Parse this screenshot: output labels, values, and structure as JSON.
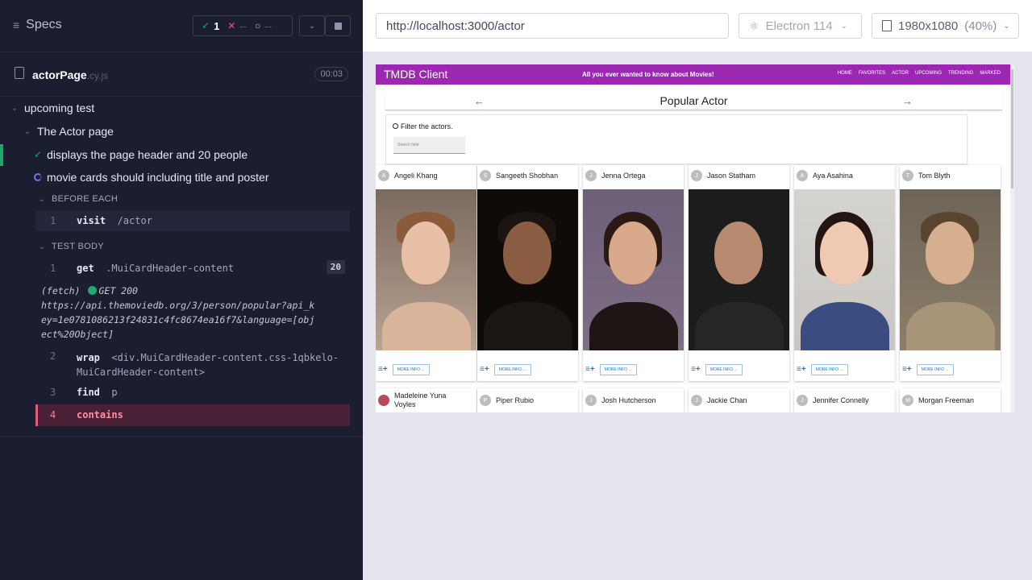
{
  "reporter": {
    "header": {
      "title": "Specs",
      "passed_count": "1",
      "failed_count": "--",
      "pending_count": "--"
    },
    "spec": {
      "name": "actorPage",
      "ext": ".cy.js",
      "time": "00:03"
    },
    "tree": {
      "suite": "upcoming test",
      "subsuite": "The Actor page",
      "test_pass": "displays the page header and 20 people",
      "test_running": "movie cards should including title and poster",
      "before_each_label": "BEFORE EACH",
      "test_body_label": "TEST BODY"
    },
    "commands": {
      "before_each": [
        {
          "num": "1",
          "name": "visit",
          "arg": "/actor"
        }
      ],
      "body": [
        {
          "num": "1",
          "name": "get",
          "arg": ".MuiCardHeader-content",
          "badge": "20"
        },
        {
          "num": "2",
          "name": "wrap",
          "arg": "<div.MuiCardHeader-content.css-1qbkelo-MuiCardHeader-content>"
        },
        {
          "num": "3",
          "name": "find",
          "arg": "p"
        },
        {
          "num": "4",
          "name": "contains",
          "arg": ""
        }
      ],
      "fetch": {
        "label": "(fetch)",
        "status": "GET 200",
        "url": "https://api.themoviedb.org/3/person/popular?api_key=1e0781086213f24831c4fc8674ea16f7&language=[object%20Object]"
      }
    }
  },
  "aut": {
    "url": "http://localhost:3000/actor",
    "browser": "Electron 114",
    "viewport": "1980x1080",
    "zoom": "(40%)",
    "app": {
      "logo": "TMDB Client",
      "tagline": "All you ever wanted to know about Movies!",
      "nav": [
        "HOME",
        "FAVORITES",
        "ACTOR",
        "UPCOMING",
        "TRENDING",
        "MARKED"
      ],
      "page_title": "Popular Actor",
      "filter_title": "Filter the actors.",
      "search_placeholder": "Search field",
      "more_info_label": "MORE INFO ...",
      "actors_row1": [
        {
          "initial": "A",
          "name": "Angeli Khang"
        },
        {
          "initial": "S",
          "name": "Sangeeth Shobhan"
        },
        {
          "initial": "J",
          "name": "Jenna Ortega"
        },
        {
          "initial": "J",
          "name": "Jason Statham"
        },
        {
          "initial": "A",
          "name": "Aya Asahina"
        },
        {
          "initial": "T",
          "name": "Tom Blyth"
        }
      ],
      "actors_row2": [
        {
          "initial": "",
          "name": "Madeleine Yuna Voyles"
        },
        {
          "initial": "P",
          "name": "Piper Rubio"
        },
        {
          "initial": "J",
          "name": "Josh Hutcherson"
        },
        {
          "initial": "J",
          "name": "Jackie Chan"
        },
        {
          "initial": "J",
          "name": "Jennifer Connelly"
        },
        {
          "initial": "M",
          "name": "Morgan Freeman"
        }
      ]
    }
  },
  "colors": {
    "accent_purple": "#9c27b0",
    "pass_green": "#1fa971",
    "fail_red": "#e05a7a",
    "link_blue": "#1976d2"
  }
}
